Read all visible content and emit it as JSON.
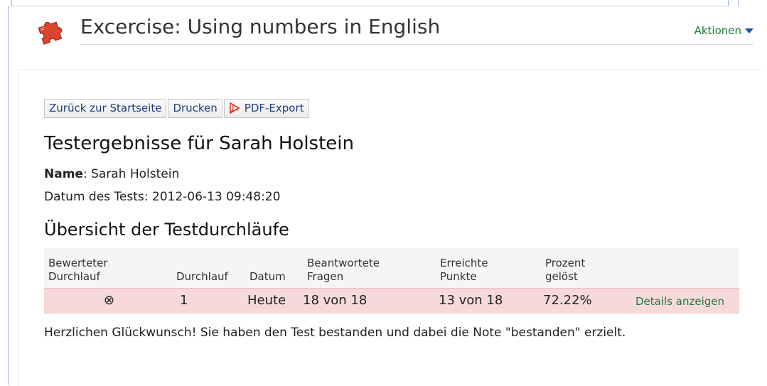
{
  "header": {
    "title": "Excercise: Using numbers in English",
    "actions_label": "Aktionen"
  },
  "toolbar": {
    "back_label": "Zurück zur Startseite",
    "print_label": "Drucken",
    "pdf_label": "PDF-Export"
  },
  "result": {
    "heading": "Testergebnisse für Sarah Holstein",
    "name_label": "Name",
    "name_value": ": Sarah Holstein",
    "date_line": "Datum des Tests: 2012-06-13 09:48:20"
  },
  "overview": {
    "heading": "Übersicht der Testdurchläufe",
    "columns": {
      "scored_run_1": "Bewerteter",
      "scored_run_2": "Durchlauf",
      "run": "Durchlauf",
      "date": "Datum",
      "answered_1": "Beantwortete",
      "answered_2": "Fragen",
      "points_1": "Erreichte",
      "points_2": "Punkte",
      "percent_1": "Prozent",
      "percent_2": "gelöst"
    },
    "rows": [
      {
        "scored_marker": "⊗",
        "run": "1",
        "date": "Heute",
        "answered": "18 von 18",
        "points": "13 von 18",
        "percent": "72.22%",
        "details": "Details anzeigen"
      }
    ]
  },
  "message": "Herzlichen Glückwunsch! Sie haben den Test bestanden und dabei die Note \"bestanden\" erzielt.",
  "colors": {
    "link_green": "#1c7b38",
    "row_highlight": "#f8d9d9",
    "puzzle_red": "#d9452e"
  },
  "icons": {
    "puzzle": "puzzle-icon",
    "pdf": "pdf-icon",
    "dropdown": "caret-down-icon"
  }
}
